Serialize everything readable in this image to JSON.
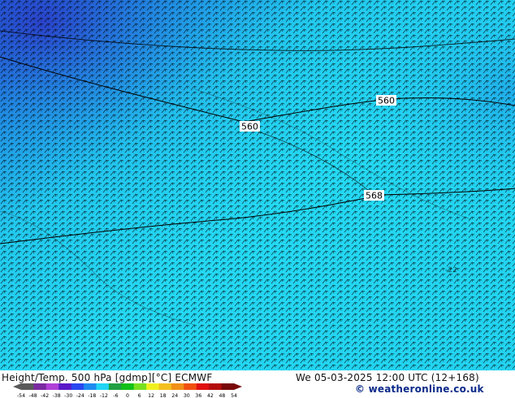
{
  "footer": {
    "title": "Height/Temp. 500 hPa [gdmp][°C] ECMWF",
    "datetime": "We 05-03-2025 12:00 UTC (12+168)",
    "site": "© weatheronline.co.uk"
  },
  "colorbar": {
    "ticks": [
      "-54",
      "-48",
      "-42",
      "-38",
      "-30",
      "-24",
      "-18",
      "-12",
      "-6",
      "0",
      "6",
      "12",
      "18",
      "24",
      "30",
      "36",
      "42",
      "48",
      "54"
    ],
    "colors": [
      "#5a5a5a",
      "#7a2aa0",
      "#b040d8",
      "#5a18c8",
      "#2a48f0",
      "#1e8af0",
      "#22d4f4",
      "#20a040",
      "#10c018",
      "#78e020",
      "#f0f020",
      "#f4c020",
      "#f09018",
      "#f05010",
      "#e01010",
      "#b40c0c",
      "#780808"
    ]
  },
  "map": {
    "contour_labels": [
      "560",
      "560",
      "568"
    ],
    "field_label": "-22"
  }
}
